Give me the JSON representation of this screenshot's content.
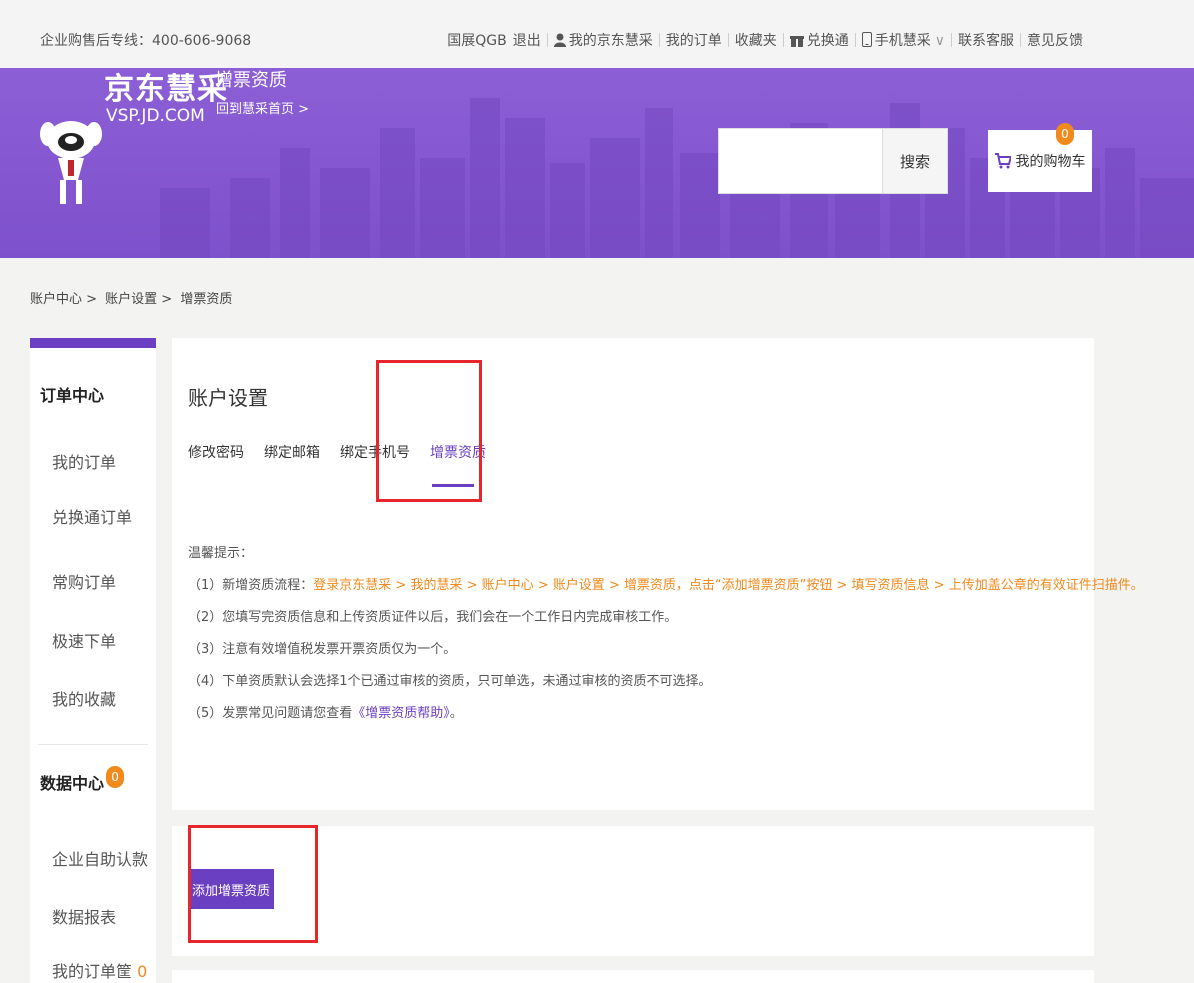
{
  "topbar": {
    "hotline": "企业购售后专线：400-606-9068",
    "user": "国展QGB",
    "logout": "退出",
    "my_vsp": "我的京东慧采",
    "my_orders": "我的订单",
    "favorites": "收藏夹",
    "exchange": "兑换通",
    "mobile": "手机慧采",
    "service": "联系客服",
    "feedback": "意见反馈"
  },
  "header": {
    "logo_cn": "京东慧采",
    "logo_en": "VSP.JD.COM",
    "subtitle": "增票资质",
    "back_home": "回到慧采首页 >",
    "search_placeholder": "",
    "search_button": "搜索",
    "cart_label": "我的购物车",
    "cart_count": "0"
  },
  "breadcrumb": {
    "items": [
      "账户中心 >",
      "账户设置 >",
      "增票资质"
    ]
  },
  "sidebar": {
    "order_center": "订单中心",
    "order_items": [
      "我的订单",
      "兑换通订单",
      "常购订单",
      "极速下单",
      "我的收藏"
    ],
    "data_center": "数据中心",
    "data_badge": "0",
    "data_items": [
      "企业自助认款",
      "数据报表"
    ],
    "order_basket": "我的订单筐",
    "order_basket_count": "0"
  },
  "main": {
    "title": "账户设置",
    "tabs": [
      "修改密码",
      "绑定邮箱",
      "绑定手机号",
      "增票资质"
    ],
    "active_tab": "增票资质",
    "tips_title": "温馨提示：",
    "tip1_prefix": "（1）新增资质流程：",
    "tip1_highlight": "登录京东慧采 > 我的慧采 > 账户中心 > 账户设置 > 增票资质，点击“添加增票资质”按钮 > 填写资质信息 > 上传加盖公章的有效证件扫描件。",
    "tip2": "（2）您填写完资质信息和上传资质证件以后，我们会在一个工作日内完成审核工作。",
    "tip3": "（3）注意有效增值税发票开票资质仅为一个。",
    "tip4": "（4）下单资质默认会选择1个已通过审核的资质，只可单选，未通过审核的资质不可选择。",
    "tip5_prefix": "（5）发票常见问题请您查看",
    "tip5_link": "《增票资质帮助》",
    "tip5_suffix": "。",
    "add_button": "添加增票资质"
  },
  "colors": {
    "brand_purple": "#6b3fc1",
    "header_purple": "#8c5fd6",
    "orange": "#f08a1c",
    "annotation_red": "#e6262a"
  }
}
